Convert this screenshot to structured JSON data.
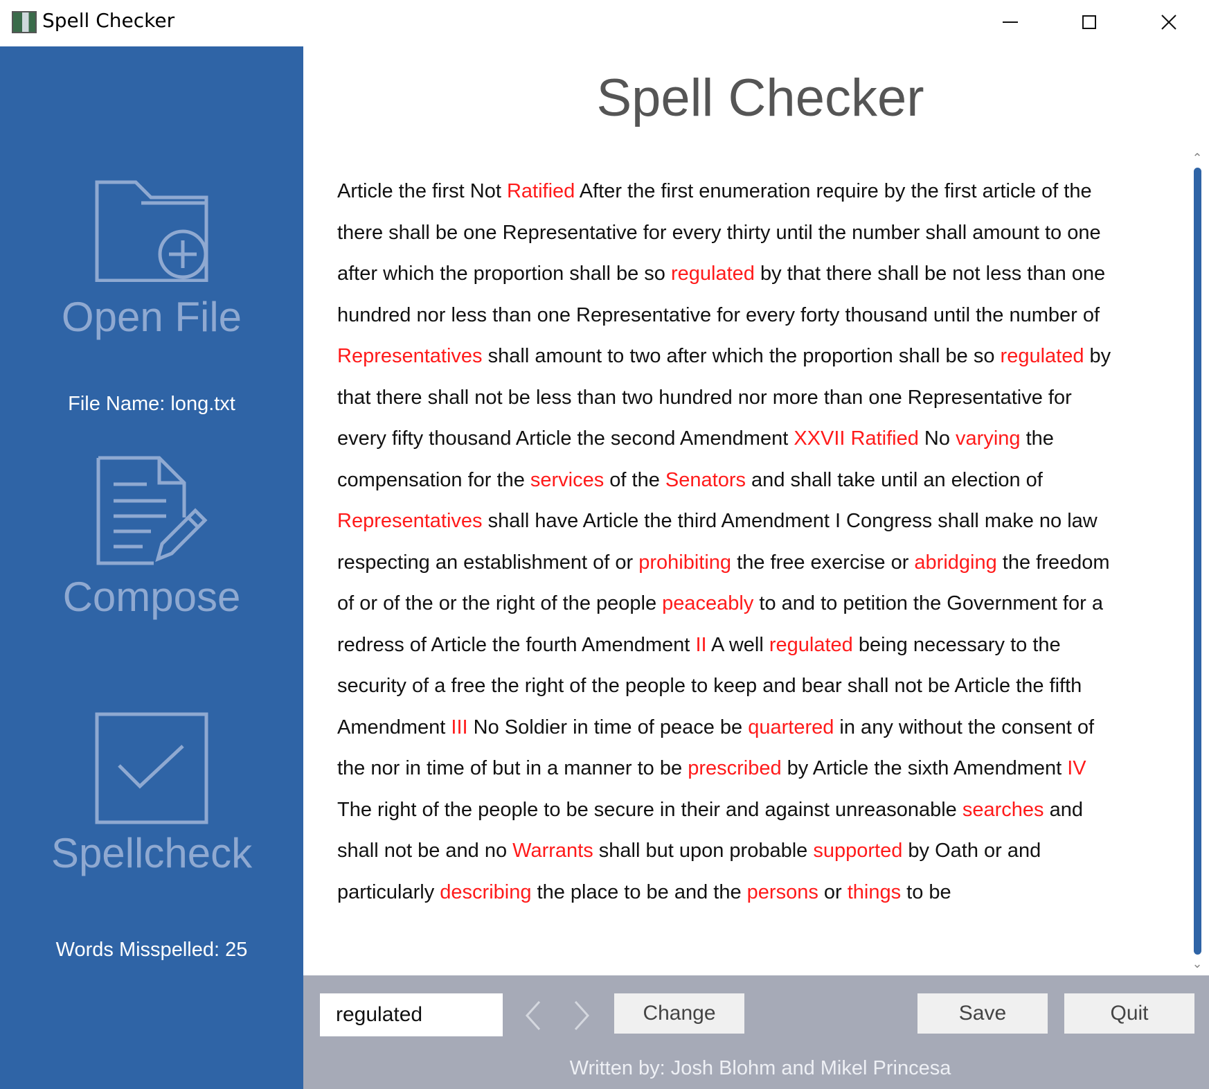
{
  "window": {
    "title": "Spell Checker",
    "minimize_icon": "minimize-icon",
    "maximize_icon": "maximize-icon",
    "close_icon": "close-icon"
  },
  "sidebar": {
    "open_file": {
      "label": "Open File",
      "icon": "folder-add-icon"
    },
    "file_name": "File Name: long.txt",
    "compose": {
      "label": "Compose",
      "icon": "document-edit-icon"
    },
    "spellcheck": {
      "label": "Spellcheck",
      "icon": "checkbox-icon"
    },
    "words_misspelled": "Words Misspelled: 25",
    "background_color": "#2f64a6"
  },
  "main": {
    "title": "Spell Checker",
    "misspelled_color": "#ff1a1a",
    "lines": [
      [
        {
          "t": "Article the first Not "
        },
        {
          "t": "Ratified",
          "m": true
        },
        {
          "t": " After the first enumeration require by the first article of the"
        }
      ],
      [
        {
          "t": "there shall be one Representative for every thirty until the number shall amount to one"
        }
      ],
      [
        {
          "t": "after which the proportion shall be so "
        },
        {
          "t": "regulated",
          "m": true
        },
        {
          "t": " by that there shall be not less than one"
        }
      ],
      [
        {
          "t": "hundred nor less than one Representative for every forty thousand until the number of"
        }
      ],
      [
        {
          "t": "Representatives",
          "m": true
        },
        {
          "t": " shall amount to two after which the proportion shall be so "
        },
        {
          "t": "regulated",
          "m": true
        },
        {
          "t": " by"
        }
      ],
      [
        {
          "t": "that there shall not be less than two hundred nor more than one Representative for"
        }
      ],
      [
        {
          "t": "every fifty thousand Article the second Amendment "
        },
        {
          "t": "XXVII Ratified",
          "m": true
        },
        {
          "t": " No "
        },
        {
          "t": "varying",
          "m": true
        },
        {
          "t": " the"
        }
      ],
      [
        {
          "t": "compensation for the "
        },
        {
          "t": "services",
          "m": true
        },
        {
          "t": " of the "
        },
        {
          "t": "Senators",
          "m": true
        },
        {
          "t": " and shall take until an election of"
        }
      ],
      [
        {
          "t": "Representatives",
          "m": true
        },
        {
          "t": " shall have Article the third Amendment I Congress shall make no law"
        }
      ],
      [
        {
          "t": "respecting an establishment of or "
        },
        {
          "t": "prohibiting",
          "m": true
        },
        {
          "t": " the free exercise or "
        },
        {
          "t": "abridging",
          "m": true
        },
        {
          "t": " the freedom"
        }
      ],
      [
        {
          "t": "of or of the or the right of the people "
        },
        {
          "t": "peaceably",
          "m": true
        },
        {
          "t": " to and to petition the Government for a"
        }
      ],
      [
        {
          "t": "redress of Article the fourth Amendment "
        },
        {
          "t": "II",
          "m": true
        },
        {
          "t": " A well "
        },
        {
          "t": "regulated",
          "m": true
        },
        {
          "t": " being necessary to the"
        }
      ],
      [
        {
          "t": "security of a free the right of the people to keep and bear shall not be Article the fifth"
        }
      ],
      [
        {
          "t": "Amendment "
        },
        {
          "t": "III",
          "m": true
        },
        {
          "t": " No Soldier in time of peace be "
        },
        {
          "t": "quartered",
          "m": true
        },
        {
          "t": " in any without the consent of"
        }
      ],
      [
        {
          "t": "the nor in time of but in a manner to be "
        },
        {
          "t": "prescribed",
          "m": true
        },
        {
          "t": " by Article the sixth Amendment "
        },
        {
          "t": "IV",
          "m": true
        }
      ],
      [
        {
          "t": "The right of the people to be secure in their and against unreasonable "
        },
        {
          "t": "searches",
          "m": true
        },
        {
          "t": " and"
        }
      ],
      [
        {
          "t": "shall not be and no "
        },
        {
          "t": "Warrants",
          "m": true
        },
        {
          "t": " shall but upon probable "
        },
        {
          "t": "supported",
          "m": true
        },
        {
          "t": " by Oath or and"
        }
      ],
      [
        {
          "t": "particularly "
        },
        {
          "t": "describing",
          "m": true
        },
        {
          "t": " the place to be and the "
        },
        {
          "t": "persons",
          "m": true
        },
        {
          "t": " or "
        },
        {
          "t": "things",
          "m": true
        },
        {
          "t": " to be"
        }
      ]
    ]
  },
  "bottom": {
    "word_input_value": "regulated",
    "prev_icon": "chevron-left-icon",
    "next_icon": "chevron-right-icon",
    "change_label": "Change",
    "save_label": "Save",
    "quit_label": "Quit",
    "credit": "Written by: Josh Blohm and Mikel Princesa"
  }
}
